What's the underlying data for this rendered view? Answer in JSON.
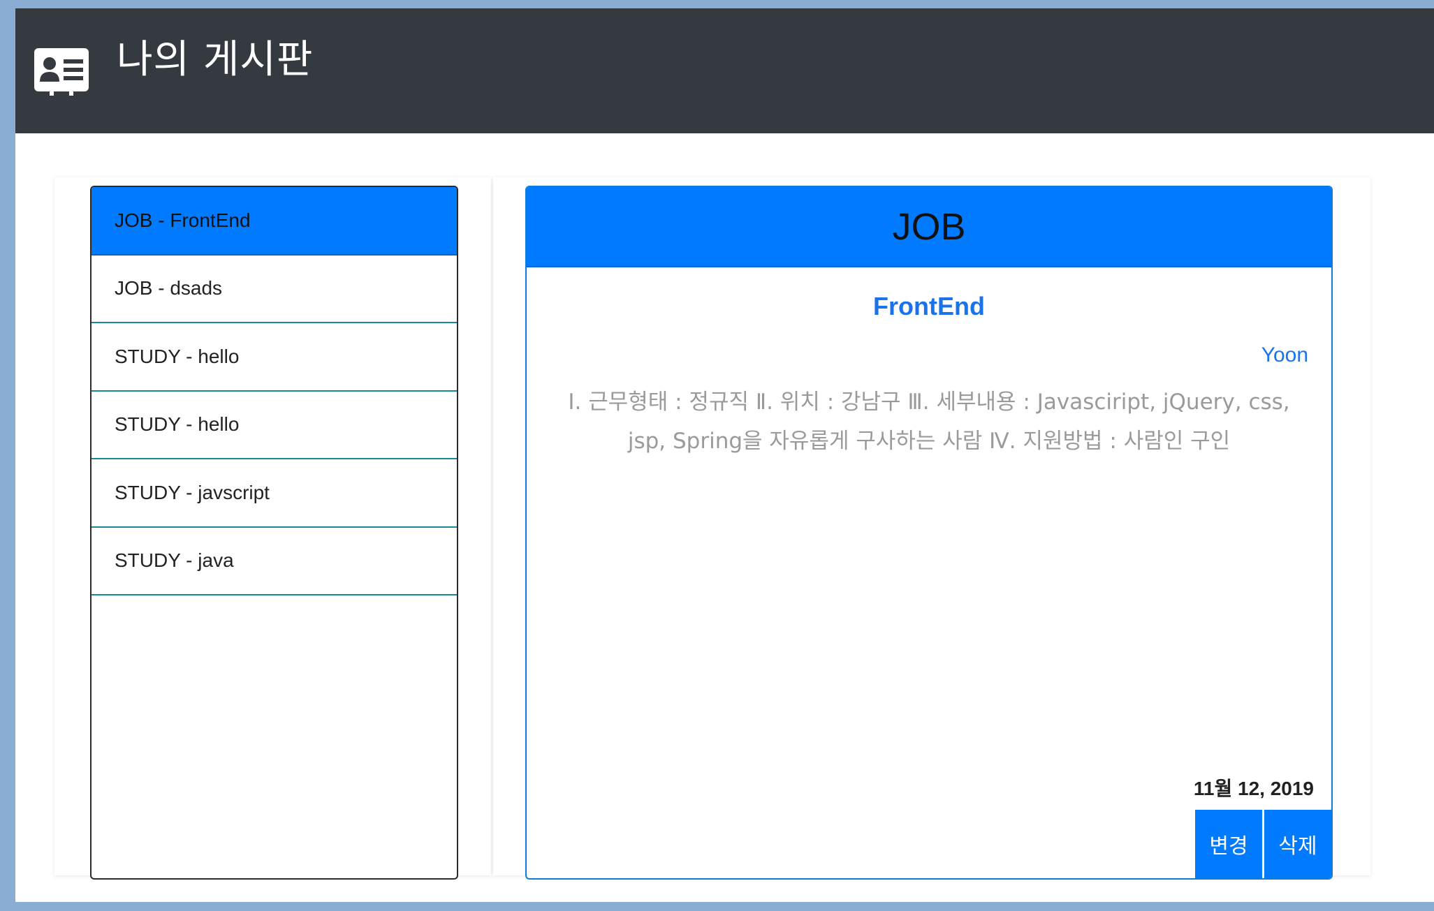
{
  "navbar": {
    "brand": "나의 게시판",
    "logo_icon": "address-card-icon"
  },
  "list": {
    "items": [
      {
        "label": "JOB - FrontEnd",
        "active": true
      },
      {
        "label": "JOB - dsads",
        "active": false
      },
      {
        "label": "STUDY - hello",
        "active": false
      },
      {
        "label": "STUDY - hello",
        "active": false
      },
      {
        "label": "STUDY - javscript",
        "active": false
      },
      {
        "label": "STUDY - java",
        "active": false
      }
    ]
  },
  "detail": {
    "category": "JOB",
    "title": "FrontEnd",
    "author": "Yoon",
    "body": "Ⅰ. 근무형태 : 정규직 Ⅱ. 위치 : 강남구 Ⅲ. 세부내용 : Javasciript, jQuery, css, jsp, Spring을 자유롭게 구사하는 사람 Ⅳ. 지원방법 : 사람인 구인",
    "date": "11월 12, 2019",
    "edit_label": "변경",
    "delete_label": "삭제"
  },
  "colors": {
    "navbar_bg": "#343a40",
    "primary": "#007bff",
    "page_bg": "#8aaed3",
    "link_text": "#1a73e8"
  }
}
